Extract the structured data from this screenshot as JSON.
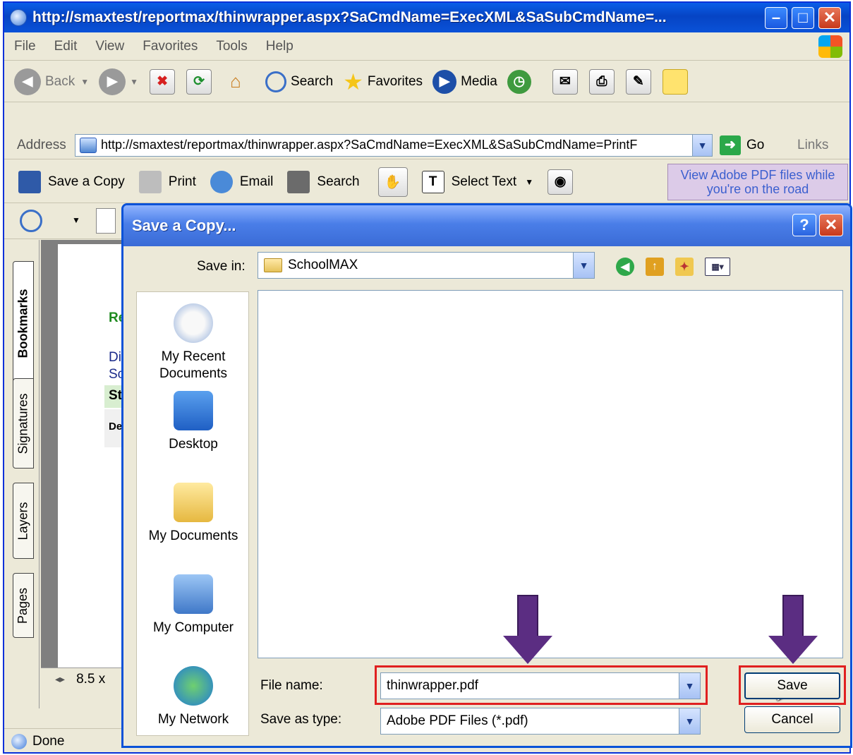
{
  "browser": {
    "title": "http://smaxtest/reportmax/thinwrapper.aspx?SaCmdName=ExecXML&SaSubCmdName=...",
    "menu": [
      "File",
      "Edit",
      "View",
      "Favorites",
      "Tools",
      "Help"
    ],
    "toolbar": {
      "back": "Back",
      "search": "Search",
      "favorites": "Favorites",
      "media": "Media"
    },
    "address": {
      "label": "Address",
      "url": "http://smaxtest/reportmax/thinwrapper.aspx?SaCmdName=ExecXML&SaSubCmdName=PrintF",
      "go": "Go",
      "links": "Links"
    },
    "status": "Done"
  },
  "acrobat": {
    "save_copy": "Save a Copy",
    "print": "Print",
    "email": "Email",
    "search": "Search",
    "select_text": "Select Text",
    "ad_line1": "View Adobe PDF files while",
    "ad_line2": "you're on the road",
    "tabs": [
      "Bookmarks",
      "Signatures",
      "Layers",
      "Pages"
    ],
    "page_size": "8.5 x",
    "doc_fragments": [
      "Re",
      "Di",
      "Sc",
      "St",
      "De"
    ]
  },
  "dialog": {
    "title": "Save a Copy...",
    "save_in_label": "Save in:",
    "save_in_value": "SchoolMAX",
    "places": [
      {
        "line1": "My Recent",
        "line2": "Documents"
      },
      {
        "line1": "Desktop",
        "line2": ""
      },
      {
        "line1": "My Documents",
        "line2": ""
      },
      {
        "line1": "My Computer",
        "line2": ""
      },
      {
        "line1": "My Network",
        "line2": ""
      }
    ],
    "file_name_label": "File name:",
    "file_name_value": "thinwrapper.pdf",
    "save_type_label": "Save as type:",
    "save_type_value": "Adobe PDF Files (*.pdf)",
    "save_button": "Save",
    "cancel_button": "Cancel"
  },
  "colors": {
    "highlight": "#e02020",
    "arrow": "#5b2d82",
    "xp_blue": "#0a52d8"
  }
}
